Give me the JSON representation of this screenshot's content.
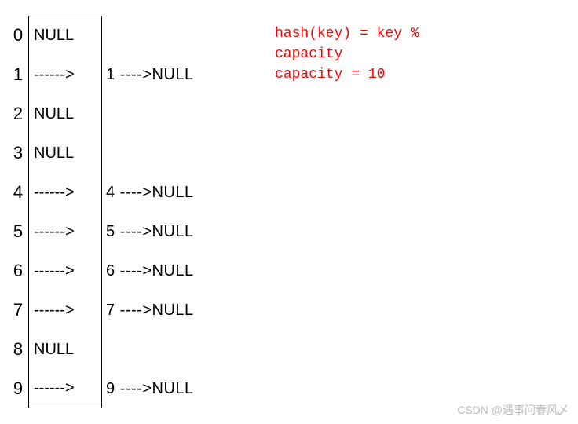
{
  "chart_data": {
    "type": "table",
    "title": "Hash table chaining diagram",
    "capacity": 10,
    "formula": "hash(key) = key % capacity",
    "buckets": [
      {
        "index": 0,
        "chain": null
      },
      {
        "index": 1,
        "chain": [
          1
        ]
      },
      {
        "index": 2,
        "chain": null
      },
      {
        "index": 3,
        "chain": null
      },
      {
        "index": 4,
        "chain": [
          4
        ]
      },
      {
        "index": 5,
        "chain": [
          5
        ]
      },
      {
        "index": 6,
        "chain": [
          6
        ]
      },
      {
        "index": 7,
        "chain": [
          7
        ]
      },
      {
        "index": 8,
        "chain": null
      },
      {
        "index": 9,
        "chain": [
          9
        ]
      }
    ]
  },
  "labels": {
    "null": "NULL",
    "arrow1": "------>",
    "arrow2": "---->",
    "sep": " "
  },
  "rows": [
    {
      "idx": "0",
      "cell": "NULL",
      "chain": ""
    },
    {
      "idx": "1",
      "cell": "------>",
      "chain": "1  ---->NULL"
    },
    {
      "idx": "2",
      "cell": "NULL",
      "chain": ""
    },
    {
      "idx": "3",
      "cell": "NULL",
      "chain": ""
    },
    {
      "idx": "4",
      "cell": "------>",
      "chain": "4  ---->NULL"
    },
    {
      "idx": "5",
      "cell": "------>",
      "chain": "5  ---->NULL"
    },
    {
      "idx": "6",
      "cell": "------>",
      "chain": "6  ---->NULL"
    },
    {
      "idx": "7",
      "cell": "------>",
      "chain": "7  ---->NULL"
    },
    {
      "idx": "8",
      "cell": "NULL",
      "chain": ""
    },
    {
      "idx": "9",
      "cell": "------>",
      "chain": "9  ---->NULL"
    }
  ],
  "formula": {
    "line1": "hash(key) = key %",
    "line2": "capacity",
    "line3": "capacity = 10"
  },
  "watermark": "CSDN @遇事问春风乄"
}
